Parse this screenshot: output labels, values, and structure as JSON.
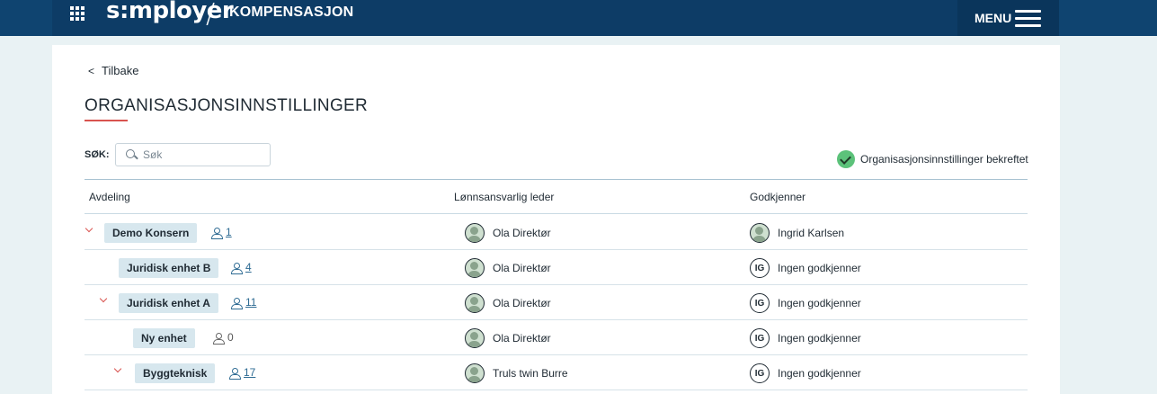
{
  "header": {
    "logo": "s:mployer",
    "product": "KOMPENSASJON",
    "menu_label": "MENU"
  },
  "page": {
    "back_label": "Tilbake",
    "title": "ORGANISASJONSINNSTILLINGER",
    "search_label": "SØK:",
    "search_placeholder": "Søk",
    "search_value": "",
    "confirm_status": "Organisasjonsinnstillinger bekreftet"
  },
  "table": {
    "columns": [
      "Avdeling",
      "Lønnsansvarlig leder",
      "Godkjenner"
    ],
    "rows": [
      {
        "unit": "Demo Konsern",
        "count": "1",
        "linked": true,
        "expandable": true,
        "leader": "Ola Direktør",
        "approver": "Ingrid Karlsen",
        "approver_initials": ""
      },
      {
        "unit": "Juridisk enhet B",
        "count": "4",
        "linked": true,
        "expandable": false,
        "leader": "Ola Direktør",
        "approver": "Ingen godkjenner",
        "approver_initials": "IG"
      },
      {
        "unit": "Juridisk enhet A",
        "count": "11",
        "linked": true,
        "expandable": true,
        "leader": "Ola Direktør",
        "approver": "Ingen godkjenner",
        "approver_initials": "IG"
      },
      {
        "unit": "Ny enhet",
        "count": "0",
        "linked": false,
        "expandable": false,
        "leader": "Ola Direktør",
        "approver": "Ingen godkjenner",
        "approver_initials": "IG"
      },
      {
        "unit": "Byggteknisk",
        "count": "17",
        "linked": true,
        "expandable": true,
        "leader": "Truls twin Burre",
        "approver": "Ingen godkjenner",
        "approver_initials": "IG"
      }
    ]
  },
  "colors": {
    "header_bg": "#0d3c66",
    "accent_red": "#d9534f",
    "tag_bg": "#d7e7ee",
    "confirm_green": "#5cc27a",
    "link_blue": "#2e6b93"
  }
}
